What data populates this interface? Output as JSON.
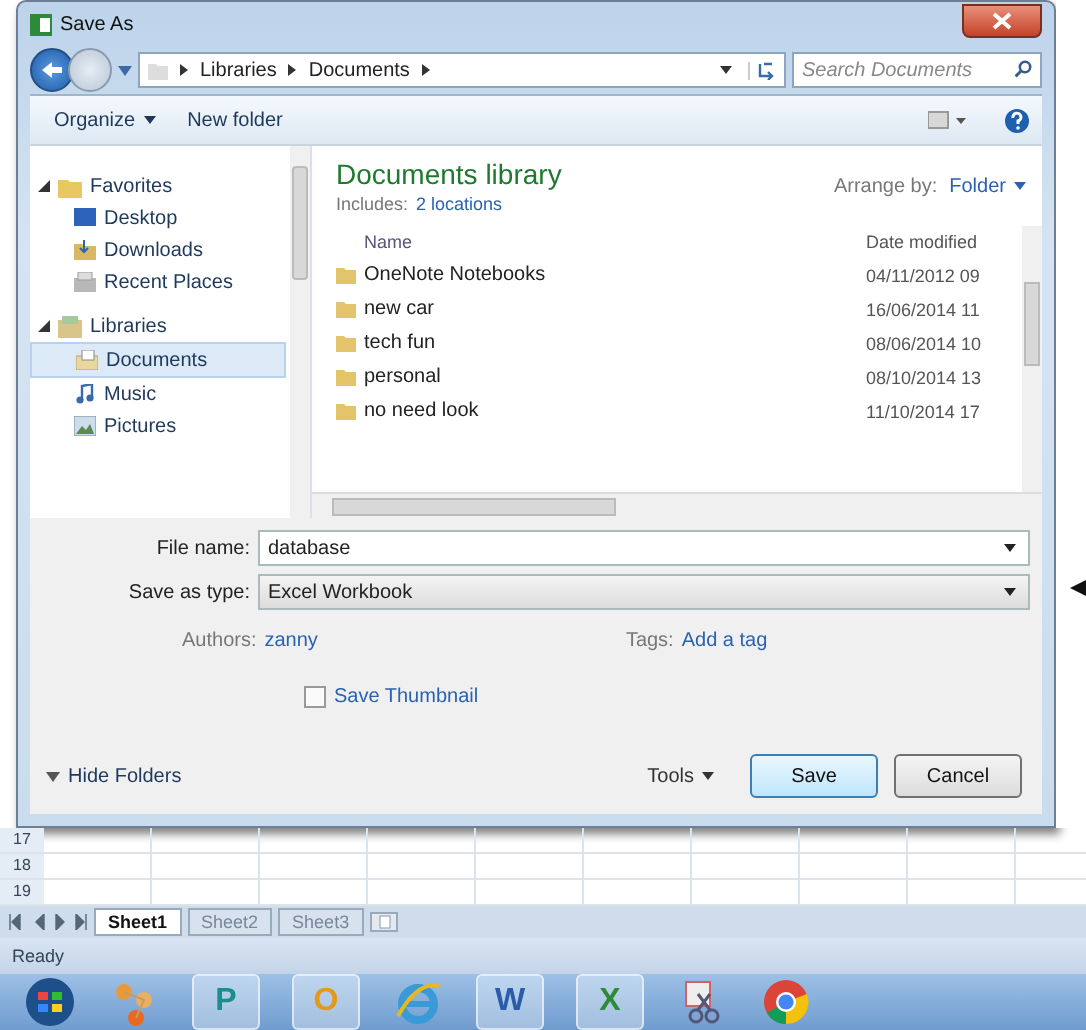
{
  "window": {
    "title": "Save As"
  },
  "address": {
    "crumbs": [
      "Libraries",
      "Documents"
    ],
    "search_placeholder": "Search Documents"
  },
  "toolbar": {
    "organize": "Organize",
    "new_folder": "New folder"
  },
  "nav": {
    "groups": [
      {
        "label": "Favorites",
        "kind": "favorites",
        "expanded": true,
        "children": [
          {
            "label": "Desktop",
            "kind": "desktop",
            "selected": false
          },
          {
            "label": "Downloads",
            "kind": "downloads",
            "selected": false
          },
          {
            "label": "Recent Places",
            "kind": "recent",
            "selected": false
          }
        ]
      },
      {
        "label": "Libraries",
        "kind": "libraries",
        "expanded": true,
        "children": [
          {
            "label": "Documents",
            "kind": "documents",
            "selected": true
          },
          {
            "label": "Music",
            "kind": "music",
            "selected": false
          },
          {
            "label": "Pictures",
            "kind": "pictures",
            "selected": false
          }
        ]
      }
    ]
  },
  "library": {
    "title": "Documents library",
    "includes_label": "Includes:",
    "includes_link": "2 locations",
    "arrange_label": "Arrange by:",
    "arrange_value": "Folder"
  },
  "file_list": {
    "columns": [
      "Name",
      "Date modified"
    ],
    "rows": [
      {
        "name": "OneNote Notebooks",
        "date": "04/11/2012 09"
      },
      {
        "name": "new car",
        "date": "16/06/2014 11"
      },
      {
        "name": "tech fun",
        "date": "08/06/2014 10"
      },
      {
        "name": "personal",
        "date": "08/10/2014 13"
      },
      {
        "name": "no need look",
        "date": "11/10/2014 17"
      }
    ]
  },
  "form": {
    "file_name_label": "File name:",
    "file_name": "database",
    "type_label": "Save as type:",
    "type_value": "Excel Workbook",
    "authors_label": "Authors:",
    "authors": "zanny",
    "tags_label": "Tags:",
    "tags": "Add a tag",
    "thumbnail": {
      "label": "Save Thumbnail",
      "checked": false
    }
  },
  "footer": {
    "hide_folders": "Hide Folders",
    "tools": "Tools",
    "save": "Save",
    "cancel": "Cancel"
  },
  "sheet": {
    "row_numbers": [
      "17",
      "18",
      "19"
    ],
    "tabs": [
      {
        "label": "Sheet1",
        "selected": true
      },
      {
        "label": "Sheet2",
        "selected": false
      },
      {
        "label": "Sheet3",
        "selected": false
      }
    ]
  },
  "status_bar": "Ready",
  "taskbar": [
    {
      "kind": "orb"
    },
    {
      "kind": "network"
    },
    {
      "kind": "tile",
      "glyph": "P",
      "color": "#1a8f8a"
    },
    {
      "kind": "tile",
      "glyph": "O",
      "color": "#e39a1c"
    },
    {
      "kind": "ie"
    },
    {
      "kind": "tile",
      "glyph": "W",
      "color": "#2a5caa"
    },
    {
      "kind": "tile",
      "glyph": "X",
      "color": "#2e8a3a"
    },
    {
      "kind": "snip"
    },
    {
      "kind": "chrome"
    }
  ]
}
